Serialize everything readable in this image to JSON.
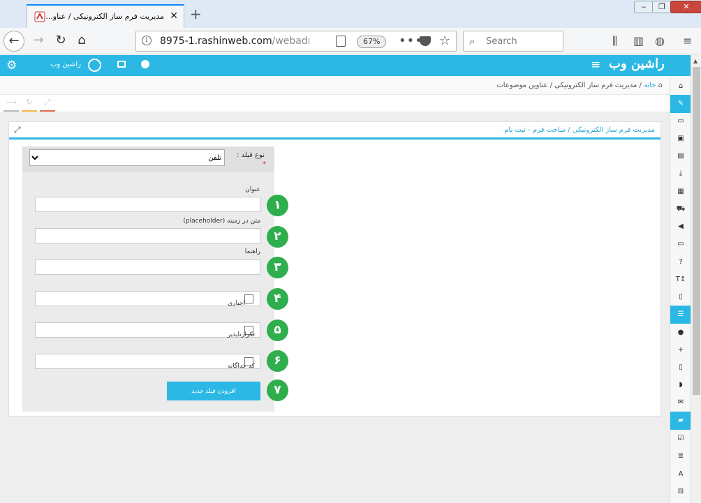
{
  "browser": {
    "tab_title": "مدیریت فرم ساز الکترونیکی / عناو...",
    "tab_close": "✕",
    "new_tab": "+",
    "url_main": "8975-1.rashinweb.com",
    "url_path": "/webadmin/",
    "zoom": "67%",
    "search_placeholder": "Search",
    "window_buttons": [
      "‒",
      "❐",
      "✕"
    ]
  },
  "app": {
    "user_name": "راشین وب",
    "logo_text": "راشین وب",
    "breadcrumb": {
      "home": "خانه",
      "separator": "/",
      "items": [
        "مدیریت فرم ساز الکترونیکی",
        "/",
        "عناوین موضوعات"
      ]
    },
    "panel_title": "مدیریت فرم ساز الکترونیکی / ساخت فرم - ثبت نام"
  },
  "form": {
    "field_type_label": "نوع فیلد :",
    "required_mark": "*",
    "field_type_value": "تلفن",
    "title_label": "عنوان",
    "placeholder_label": "متن در زمینه (placeholder)",
    "help_label": "راهنما",
    "required_label": "اجباری",
    "unique_label": "تکرارناپذیر",
    "unique_code_label": "کد جداگانه",
    "add_button": "افزودن فیلد جدید"
  },
  "badges": [
    "۱",
    "۲",
    "۳",
    "۴",
    "۵",
    "۶",
    "۷"
  ],
  "colors": {
    "accent": "#2bb8e4",
    "badge": "#2fae4e"
  }
}
